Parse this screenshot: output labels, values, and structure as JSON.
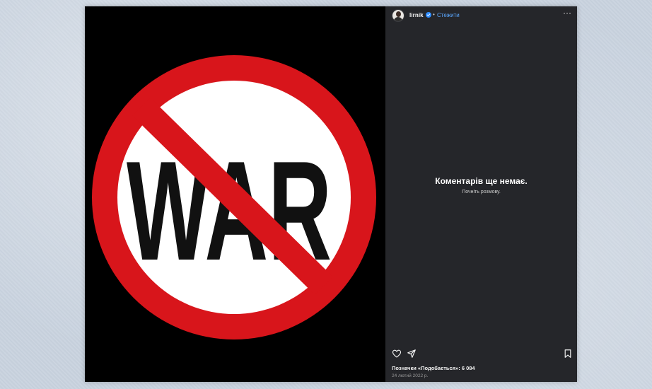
{
  "media": {
    "image_text": "WAR"
  },
  "header": {
    "username": "lirnik",
    "separator": "•",
    "follow_label": "Стежити",
    "more_label": "···"
  },
  "comments": {
    "empty_title": "Коментарів ще немає.",
    "empty_subtitle": "Почніть розмову."
  },
  "footer": {
    "likes_text": "Позначки «Подобається»: 6 084",
    "date_text": "24 лютий 2022 р."
  },
  "icons": {
    "like": "heart-icon",
    "share": "paper-plane-icon",
    "save": "bookmark-icon",
    "verified": "verified-badge-icon",
    "more": "more-options-icon"
  },
  "colors": {
    "panel_bg": "#25262a",
    "follow_link": "#5aa7ff",
    "sign_red": "#d8151b",
    "verified": "#2f8dff"
  }
}
